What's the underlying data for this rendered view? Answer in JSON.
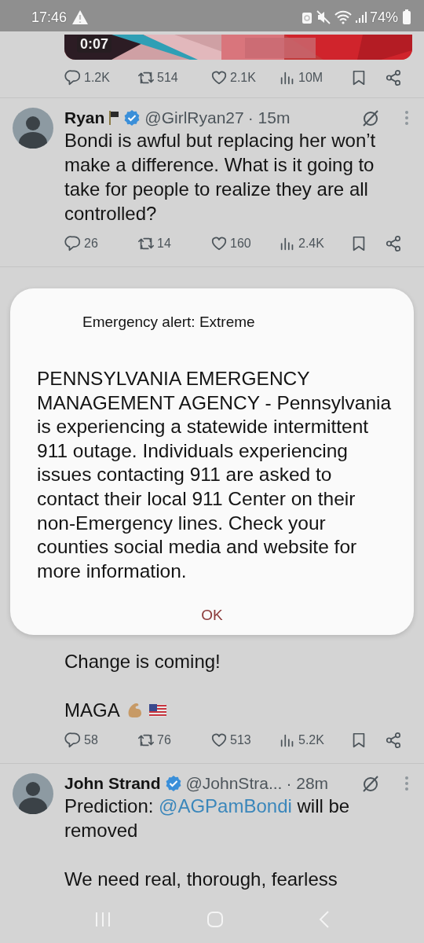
{
  "status_bar": {
    "time": "17:46",
    "battery": "74%"
  },
  "video_tweet": {
    "video": {
      "kind": "picture",
      "duration": "0:07"
    },
    "actions": [
      {
        "kind": "reply",
        "count": "1.2K"
      },
      {
        "kind": "repost",
        "count": "514"
      },
      {
        "kind": "like",
        "count": "2.1K"
      },
      {
        "kind": "views",
        "count": "10M"
      },
      {
        "kind": "bookmark"
      },
      {
        "kind": "share"
      }
    ]
  },
  "tweets": [
    {
      "header": {
        "name": "Ryan",
        "flag": true,
        "verified": true,
        "handle": "@GirlRyan27",
        "time": "· 15m"
      },
      "paragraphs": [
        [
          {
            "text": "Bondi is awful but replacing her won’t make a difference. What is it going to take for people to realize they are all controlled?"
          }
        ]
      ],
      "actions": [
        {
          "kind": "reply",
          "count": "26"
        },
        {
          "kind": "repost",
          "count": "14"
        },
        {
          "kind": "like",
          "count": "160"
        },
        {
          "kind": "views",
          "count": "2.4K"
        },
        {
          "kind": "bookmark"
        },
        {
          "kind": "share"
        }
      ]
    },
    {
      "paragraphs": [
        [
          {
            "text": "Change is coming!"
          }
        ],
        [
          {
            "text": "MAGA"
          },
          {
            "kind": "biceps_emoji"
          },
          {
            "kind": "flag_emoji"
          }
        ]
      ],
      "actions": [
        {
          "kind": "reply",
          "count": "58"
        },
        {
          "kind": "repost",
          "count": "76"
        },
        {
          "kind": "like",
          "count": "513"
        },
        {
          "kind": "views",
          "count": "5.2K"
        },
        {
          "kind": "bookmark"
        },
        {
          "kind": "share"
        }
      ]
    },
    {
      "header": {
        "name": "John Strand",
        "flag": false,
        "verified": true,
        "handle": "@JohnStra...",
        "time": "· 28m"
      },
      "paragraphs": [
        [
          {
            "text": "Prediction: "
          },
          {
            "kind": "mention",
            "text": "@AGPamBondi"
          },
          {
            "text": " will be removed"
          }
        ],
        [
          {
            "text": "We need real, thorough, fearless"
          }
        ]
      ]
    }
  ],
  "alert_dialog": {
    "title": "Emergency alert: Extreme",
    "message": "PENNSYLVANIA EMERGENCY MANAGEMENT AGENCY - Pennsylvania is experiencing a statewide intermittent 911 outage.  Individuals experiencing issues contacting 911 are asked to contact their local 911 Center on their non-Emergency lines.  Check your counties social media and website for more information.",
    "button": "OK"
  }
}
